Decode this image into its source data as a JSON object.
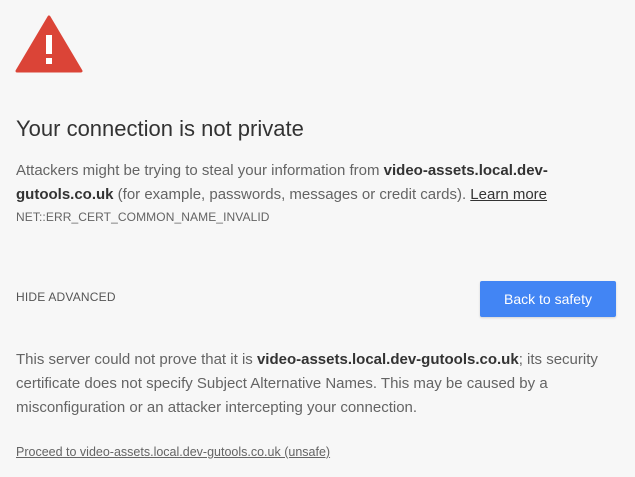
{
  "icon": {
    "name": "warning-triangle-icon",
    "color": "#db4437",
    "glyph": "!"
  },
  "heading": {
    "title": "Your connection is not private"
  },
  "main_message": {
    "before_host": "Attackers might be trying to steal your information from ",
    "host": "video-assets.local.dev-gutools.co.uk",
    "after_host": " (for example, passwords, messages or credit cards). ",
    "learn_more": "Learn more"
  },
  "error_code": "NET::ERR_CERT_COMMON_NAME_INVALID",
  "actions": {
    "hide_advanced": "HIDE ADVANCED",
    "back_to_safety": "Back to safety",
    "button_color": "#4285f4"
  },
  "details": {
    "before_host": "This server could not prove that it is ",
    "host": "video-assets.local.dev-gutools.co.uk",
    "after_host": "; its security certificate does not specify Subject Alternative Names. This may be caused by a misconfiguration or an attacker intercepting your connection.",
    "proceed_link": "Proceed to video-assets.local.dev-gutools.co.uk (unsafe)"
  }
}
